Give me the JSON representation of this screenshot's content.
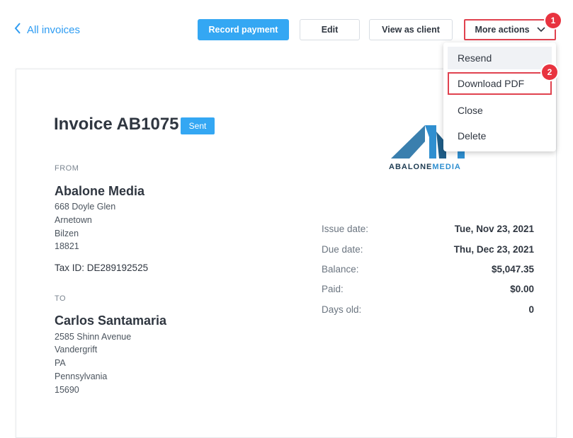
{
  "header": {
    "back_label": "All invoices",
    "record_payment_label": "Record payment",
    "edit_label": "Edit",
    "view_as_client_label": "View as client",
    "more_actions_label": "More actions"
  },
  "annotations": {
    "step1": "1",
    "step2": "2"
  },
  "dropdown": {
    "resend": "Resend",
    "download_pdf": "Download PDF",
    "close": "Close",
    "delete": "Delete"
  },
  "invoice": {
    "title": "Invoice AB1075",
    "status": "Sent",
    "from_label": "FROM",
    "to_label": "TO",
    "from": {
      "name": "Abalone Media",
      "address": [
        "668 Doyle Glen",
        "Arnetown",
        "Bilzen",
        "18821"
      ],
      "tax_id": "Tax ID: DE289192525"
    },
    "to": {
      "name": "Carlos Santamaria",
      "address": [
        "2585 Shinn Avenue",
        "Vandergrift",
        "PA",
        "Pennsylvania",
        "15690"
      ]
    },
    "details": [
      {
        "label": "Issue date:",
        "value": "Tue, Nov 23, 2021"
      },
      {
        "label": "Due date:",
        "value": "Thu, Dec 23, 2021"
      },
      {
        "label": "Balance:",
        "value": "$5,047.35"
      },
      {
        "label": "Paid:",
        "value": "$0.00"
      },
      {
        "label": "Days old:",
        "value": "0"
      }
    ]
  },
  "logo": {
    "text_dark": "ABALONE",
    "text_accent": "MEDIA"
  },
  "colors": {
    "accent": "#34a7f3",
    "highlight": "#e0424f",
    "badge": "#e8333f"
  },
  "icons": [
    "chevron-left-icon",
    "chevron-down-icon",
    "abalone-media-logo"
  ]
}
